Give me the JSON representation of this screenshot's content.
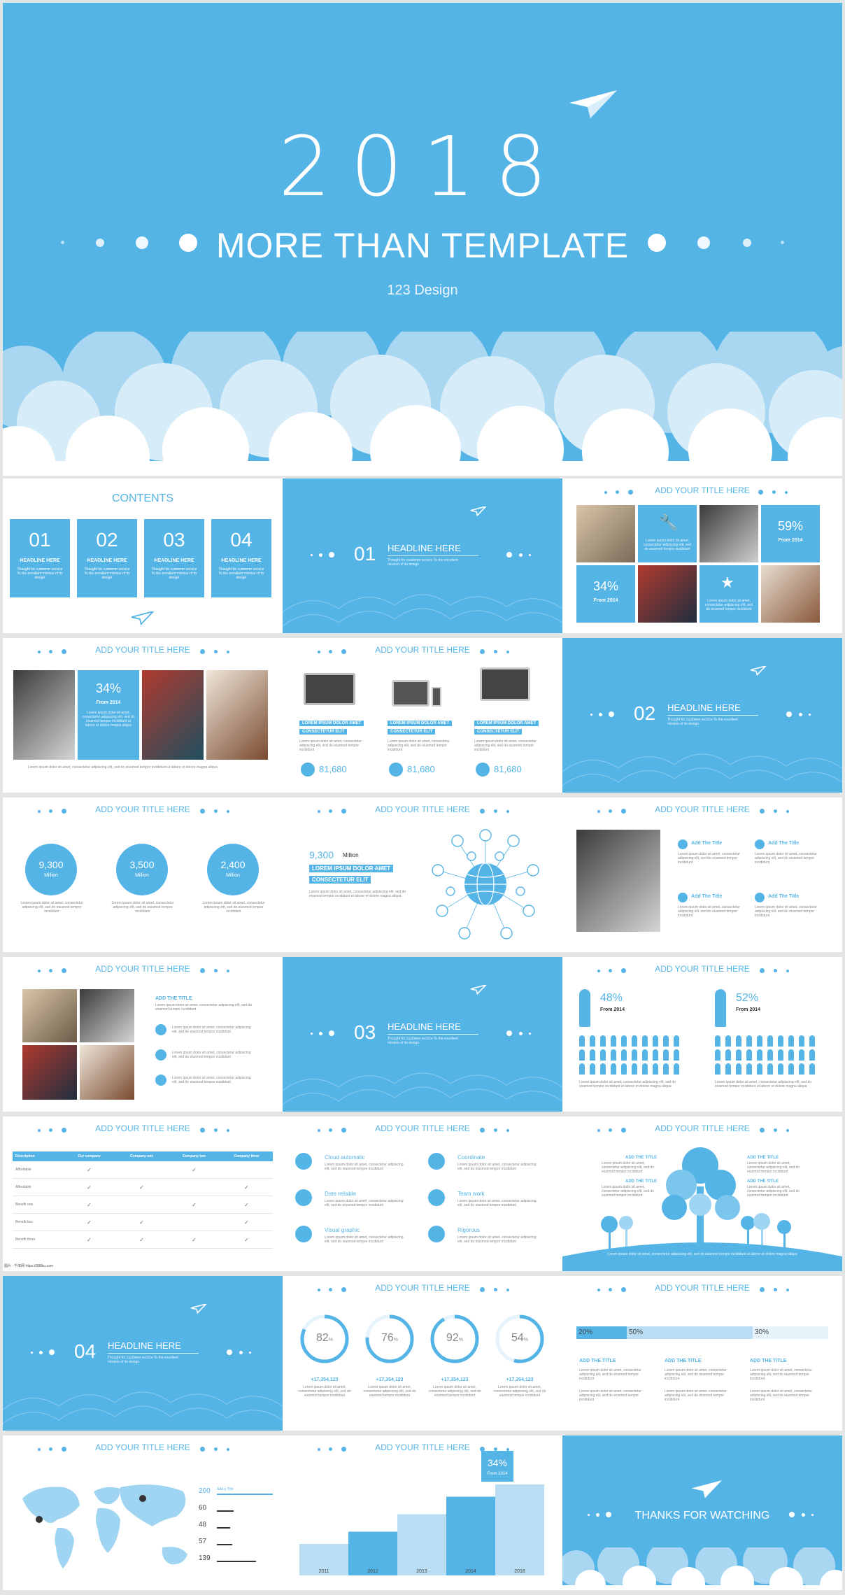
{
  "cover": {
    "year": "2018",
    "title": "MORE THAN TEMPLATE",
    "designer": "123 Design"
  },
  "theme": {
    "accent": "#55b4e6",
    "light_accent": "#b9def3",
    "background": "#e3e4e6"
  },
  "common": {
    "add_title": "ADD YOUR TITLE HERE",
    "headline": "HEADLINE HERE",
    "section_sub_1": "Thought for customer service To the excellent",
    "section_sub_2": "mission of its design",
    "lorem_short": "Lorem ipsum dolor sit amet, consectetur adipiscing elit, sed do eiusmod tempor incididunt",
    "lorem_long": "Lorem ipsum dolor sit amet, consectetur adipiscing elit, sed do eiusmod tempor incididunt ut labore et dolore magna aliqua"
  },
  "contents": {
    "title": "CONTENTS",
    "items": [
      {
        "num": "01",
        "head": "HEADLINE HERE",
        "text": "Thought for customer service To the excellent mission of its design"
      },
      {
        "num": "02",
        "head": "HEADLINE HERE",
        "text": "Thought for customer service To the excellent mission of its design"
      },
      {
        "num": "03",
        "head": "HEADLINE HERE",
        "text": "Thought for customer service To the excellent mission of its design"
      },
      {
        "num": "04",
        "head": "HEADLINE HERE",
        "text": "Thought for customer service To the excellent mission of its design"
      }
    ]
  },
  "sections": [
    "01",
    "02",
    "03",
    "04"
  ],
  "photo_grid": {
    "pct1": "59%",
    "pct2": "34%",
    "from": "From 2014"
  },
  "photo_row": {
    "pct": "34%",
    "from": "From 2014"
  },
  "devices": {
    "pill1": "LOREM IPSUM DOLOR AMET",
    "pill2": "CONSECTETUR ELIT",
    "value": "81,680"
  },
  "circles": [
    {
      "value": "9,300",
      "unit": "Million"
    },
    {
      "value": "3,500",
      "unit": "Million"
    },
    {
      "value": "2,400",
      "unit": "Million"
    }
  ],
  "network": {
    "value": "9,300",
    "unit": "Million",
    "pill1": "LOREM IPSUM DOLOR AMET",
    "pill2": "CONSECTETUR ELIT"
  },
  "add_title_items": [
    "Add The Title",
    "Add The Title",
    "Add The Title",
    "Add The Title"
  ],
  "add_the_title": "ADD THE TITLE",
  "gender": [
    {
      "pct": "48%",
      "from": "From 2014"
    },
    {
      "pct": "52%",
      "from": "From 2014"
    }
  ],
  "comparison": {
    "headers": [
      "Description",
      "Our company",
      "Company one",
      "Company two",
      "Company three"
    ],
    "rows": [
      {
        "name": "Affordable",
        "checks": [
          1,
          0,
          1,
          0
        ]
      },
      {
        "name": "Affordable",
        "checks": [
          1,
          1,
          0,
          1
        ]
      },
      {
        "name": "Benefit one",
        "checks": [
          1,
          0,
          1,
          1
        ]
      },
      {
        "name": "Benefit two",
        "checks": [
          1,
          1,
          0,
          1
        ]
      },
      {
        "name": "Benefit three",
        "checks": [
          1,
          1,
          1,
          1
        ]
      }
    ]
  },
  "features": [
    {
      "label": "Cloud automatic",
      "icon": "cloud-icon"
    },
    {
      "label": "Coordinate",
      "icon": "gear-icon"
    },
    {
      "label": "Date reliable",
      "icon": "document-icon"
    },
    {
      "label": "Team work",
      "icon": "team-icon"
    },
    {
      "label": "Visual graphic",
      "icon": "chart-icon"
    },
    {
      "label": "Rigorous",
      "icon": "search-icon"
    }
  ],
  "tree_titles": [
    "ADD THE TITLE",
    "ADD THE TITLE",
    "ADD THE TITLE",
    "ADD THE TITLE"
  ],
  "rings": [
    {
      "pct": 82,
      "label": "82",
      "amount": "+17,354,123"
    },
    {
      "pct": 76,
      "label": "76",
      "amount": "+17,354,123"
    },
    {
      "pct": 92,
      "label": "92",
      "amount": "+17,354,123"
    },
    {
      "pct": 54,
      "label": "54",
      "amount": "+17,354,123"
    }
  ],
  "progress": {
    "segments": [
      {
        "label": "20%",
        "value": 20
      },
      {
        "label": "50%",
        "value": 50
      },
      {
        "label": "30%",
        "value": 30
      }
    ],
    "titles": [
      "ADD THE TITLE",
      "ADD THE TITLE",
      "ADD THE TITLE"
    ]
  },
  "map": {
    "stats": [
      {
        "value": "200",
        "caption": "Add a Title",
        "fill": 1.0
      },
      {
        "value": "60",
        "caption": "",
        "fill": 0.3
      },
      {
        "value": "48",
        "caption": "",
        "fill": 0.24
      },
      {
        "value": "57",
        "caption": "",
        "fill": 0.28
      },
      {
        "value": "139",
        "caption": "",
        "fill": 0.7
      }
    ]
  },
  "chart_data": {
    "type": "bar",
    "categories": [
      "2011",
      "2012",
      "2013",
      "2014",
      "2018"
    ],
    "values": [
      18,
      25,
      35,
      45,
      52
    ],
    "highlight": {
      "label": "34%",
      "from": "From 2014"
    },
    "title": "ADD YOUR TITLE HERE"
  },
  "closing": {
    "text": "THANKS FOR WATCHING"
  },
  "watermark": "图片 : 千库网 https://588ku.com"
}
